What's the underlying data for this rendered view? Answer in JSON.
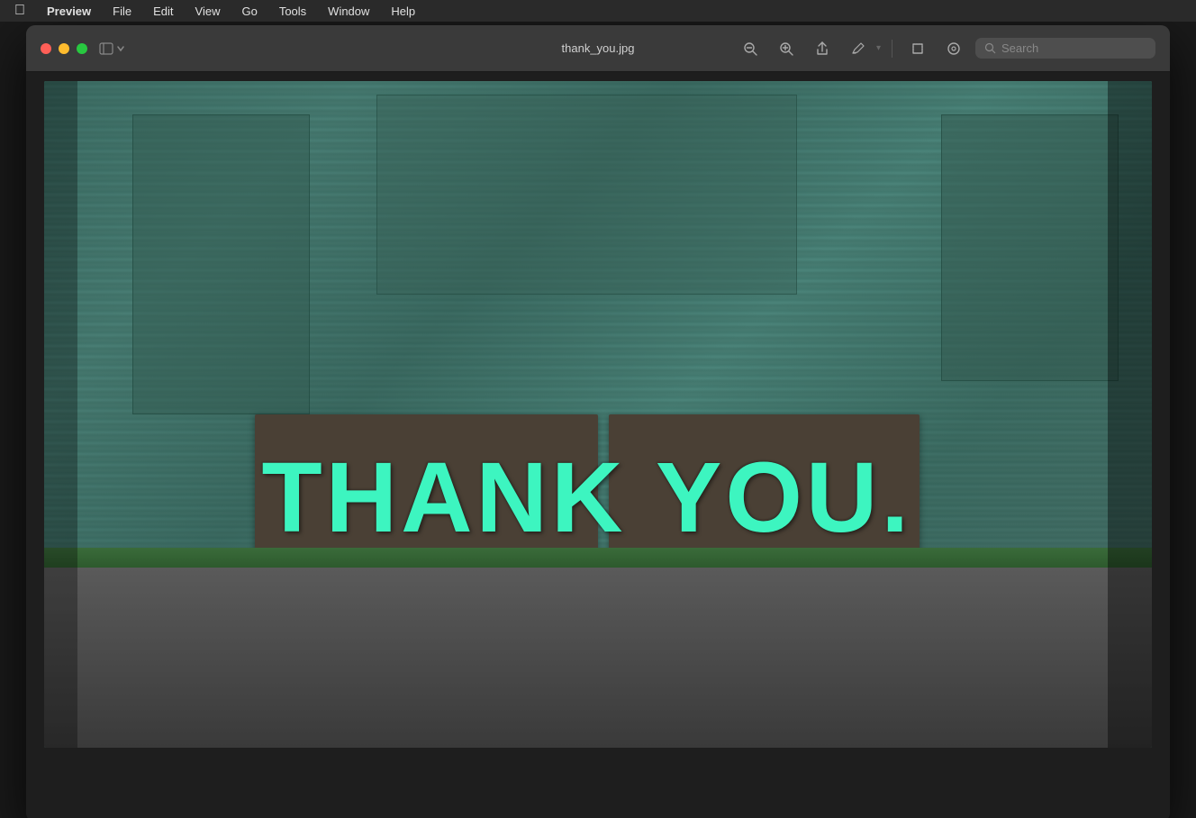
{
  "menubar": {
    "apple_label": "",
    "items": [
      {
        "id": "preview",
        "label": "Preview",
        "bold": true
      },
      {
        "id": "file",
        "label": "File"
      },
      {
        "id": "edit",
        "label": "Edit"
      },
      {
        "id": "view",
        "label": "View"
      },
      {
        "id": "go",
        "label": "Go"
      },
      {
        "id": "tools",
        "label": "Tools"
      },
      {
        "id": "window",
        "label": "Window"
      },
      {
        "id": "help",
        "label": "Help"
      }
    ]
  },
  "titlebar": {
    "filename": "thank_you.jpg",
    "search_placeholder": "Search"
  },
  "toolbar": {
    "zoom_out_label": "−",
    "zoom_in_label": "+",
    "share_label": "↑",
    "markup_label": "✎",
    "crop_label": "⬜",
    "contact_label": "◉"
  },
  "image": {
    "thank_you_text": "Thank You.",
    "alt": "A corrugated metal wall with THANK YOU. painted in teal/mint letters on wooden boards"
  },
  "colors": {
    "teal_text": "#3df5c0",
    "wall_bg": "#3d6b62",
    "wood": "#4a4035",
    "ground": "#4a4a4a",
    "menubar_bg": "#2a2a2a",
    "titlebar_bg": "#3a3a3a",
    "accent": "#ffffff"
  }
}
